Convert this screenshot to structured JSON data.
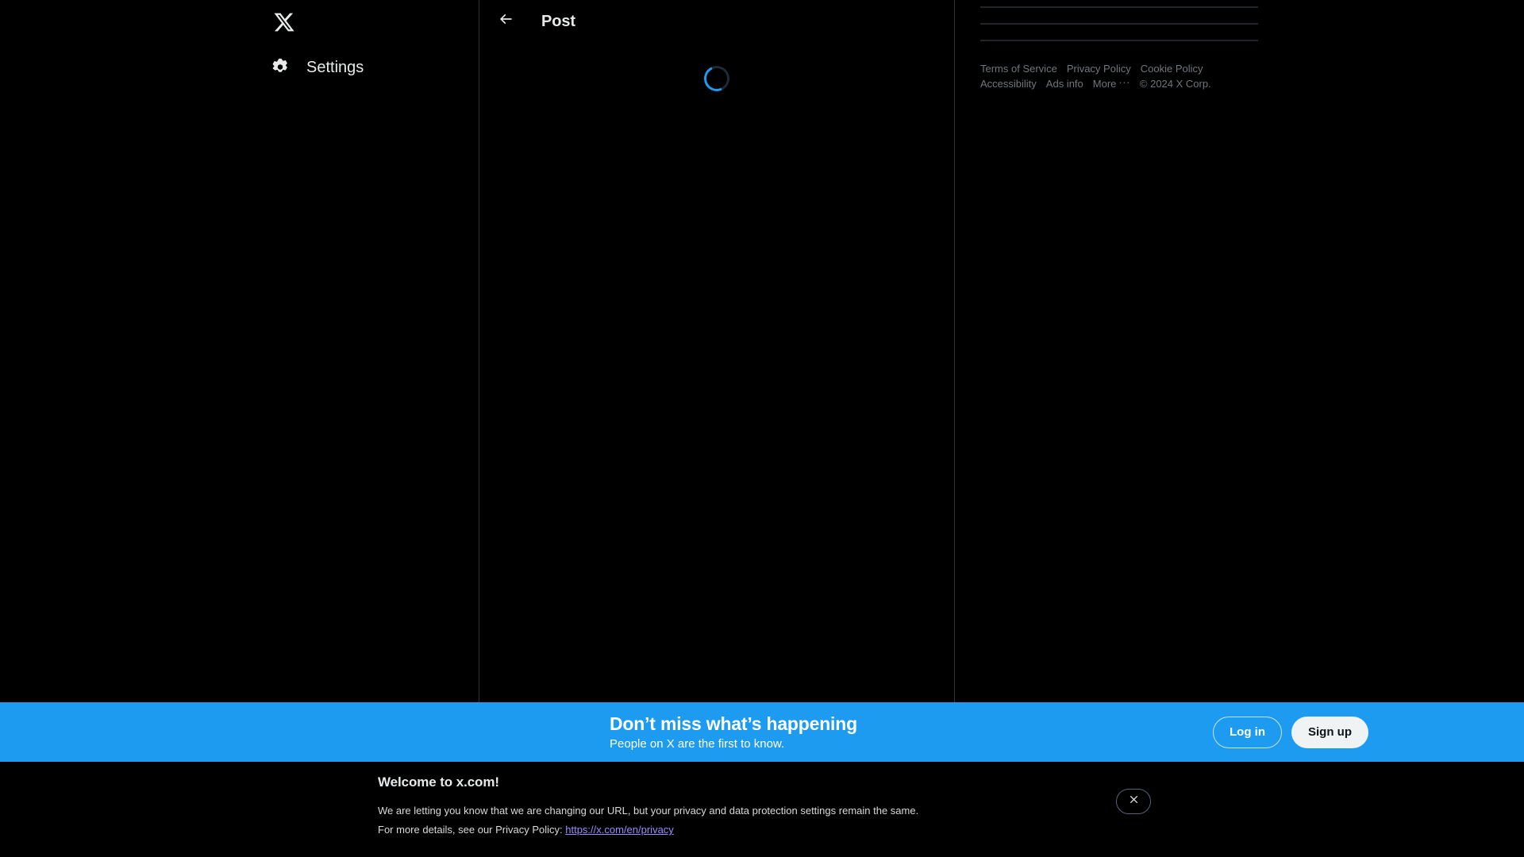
{
  "sidebar": {
    "logo_icon": "x-logo-icon",
    "items": [
      {
        "icon": "gear-icon",
        "label": "Settings"
      }
    ]
  },
  "main": {
    "back_icon": "back-arrow-icon",
    "title": "Post",
    "loading_icon": "loading-spinner-icon"
  },
  "right_sidebar": {
    "skeleton_lines": 3,
    "footer": {
      "links_row1": [
        "Terms of Service",
        "Privacy Policy",
        "Cookie Policy"
      ],
      "accessibility": "Accessibility",
      "ads_info": "Ads info",
      "more": "More",
      "more_icon": "ellipsis-icon",
      "copyright": "© 2024 X Corp."
    }
  },
  "signup_banner": {
    "title": "Don’t miss what’s happening",
    "subtitle": "People on X are the first to know.",
    "login_label": "Log in",
    "signup_label": "Sign up",
    "background_color": "#1d9bf0"
  },
  "cookie_banner": {
    "title": "Welcome to x.com!",
    "line1": "We are letting you know that we are changing our URL, but your privacy and data protection settings remain the same.",
    "line2_prefix": "For more details, see our Privacy Policy: ",
    "link_text": "https://x.com/en/privacy",
    "link_color": "#9a8cff",
    "close_icon": "close-icon"
  }
}
